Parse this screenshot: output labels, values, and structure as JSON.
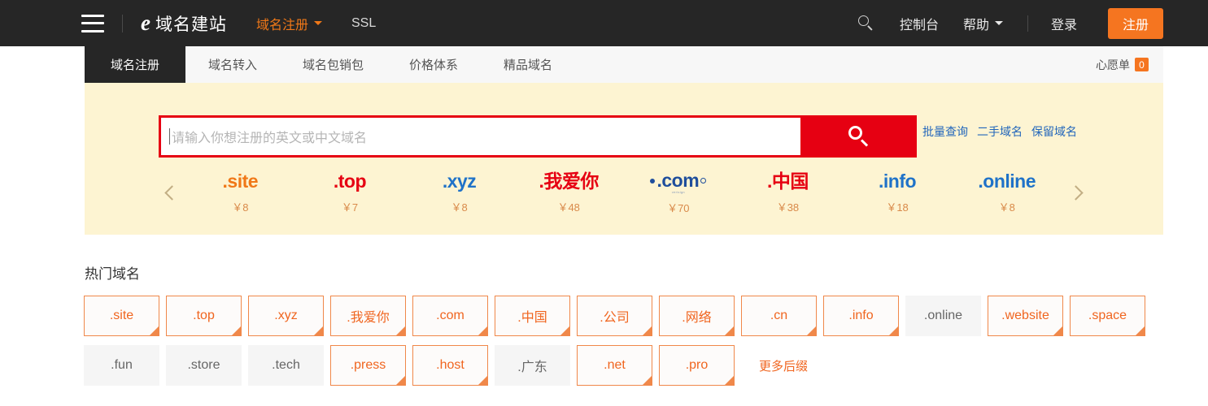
{
  "header": {
    "menu_icon": "hamburger-icon",
    "brand_mark": "e-logo-icon",
    "brand_name": "域名建站",
    "nav": [
      {
        "label": "域名注册",
        "active": true,
        "has_caret": true
      },
      {
        "label": "SSL",
        "active": false,
        "has_caret": false
      }
    ],
    "search_icon": "search-icon",
    "console_label": "控制台",
    "help_label": "帮助",
    "login_label": "登录",
    "register_label": "注册",
    "accent_orange": "#f57520",
    "background": "#262626"
  },
  "tabs": {
    "items": [
      {
        "label": "域名注册",
        "active": true
      },
      {
        "label": "域名转入",
        "active": false
      },
      {
        "label": "域名包销包",
        "active": false
      },
      {
        "label": "价格体系",
        "active": false
      },
      {
        "label": "精品域名",
        "active": false
      }
    ],
    "wishlist_label": "心愿单",
    "wishlist_count": "0"
  },
  "search": {
    "placeholder": "请输入你想注册的英文或中文域名",
    "value": "",
    "button_icon": "search-icon",
    "button_color": "#e60012",
    "links": [
      {
        "label": "批量查询"
      },
      {
        "label": "二手域名"
      },
      {
        "label": "保留域名"
      }
    ]
  },
  "carousel": {
    "prev_icon": "chevron-left-icon",
    "next_icon": "chevron-right-icon",
    "slides": [
      {
        "name": ".site",
        "price": "￥8",
        "color": "#f07818",
        "style": "plain"
      },
      {
        "name": ".top",
        "price": "￥7",
        "color": "#e60012",
        "style": "plain"
      },
      {
        "name": ".xyz",
        "price": "￥8",
        "color": "#1f72c8",
        "style": "dotblue"
      },
      {
        "name": ".我爱你",
        "price": "￥48",
        "color": "#e60012",
        "style": "dotred"
      },
      {
        "name": ".com",
        "price": "￥70",
        "color": "#1f4e9c",
        "style": "comlogo",
        "sub": "verisign"
      },
      {
        "name": ".中国",
        "price": "￥38",
        "color": "#e60012",
        "style": "plain"
      },
      {
        "name": ".info",
        "price": "￥18",
        "color": "#1f72c8",
        "style": "plain"
      },
      {
        "name": ".online",
        "price": "￥8",
        "color": "#1f72c8",
        "style": "plain"
      }
    ]
  },
  "hot": {
    "title": "热门域名",
    "more_label": "更多后缀",
    "chips": [
      {
        "label": ".site",
        "active": true
      },
      {
        "label": ".top",
        "active": true
      },
      {
        "label": ".xyz",
        "active": true
      },
      {
        "label": ".我爱你",
        "active": true
      },
      {
        "label": ".com",
        "active": true
      },
      {
        "label": ".中国",
        "active": true
      },
      {
        "label": ".公司",
        "active": true
      },
      {
        "label": ".网络",
        "active": true
      },
      {
        "label": ".cn",
        "active": true
      },
      {
        "label": ".info",
        "active": true
      },
      {
        "label": ".online",
        "active": false
      },
      {
        "label": ".website",
        "active": true
      },
      {
        "label": ".space",
        "active": true
      },
      {
        "label": ".fun",
        "active": false
      },
      {
        "label": ".store",
        "active": false
      },
      {
        "label": ".tech",
        "active": false
      },
      {
        "label": ".press",
        "active": true
      },
      {
        "label": ".host",
        "active": true
      },
      {
        "label": ".广东",
        "active": false
      },
      {
        "label": ".net",
        "active": true
      },
      {
        "label": ".pro",
        "active": true
      }
    ]
  }
}
